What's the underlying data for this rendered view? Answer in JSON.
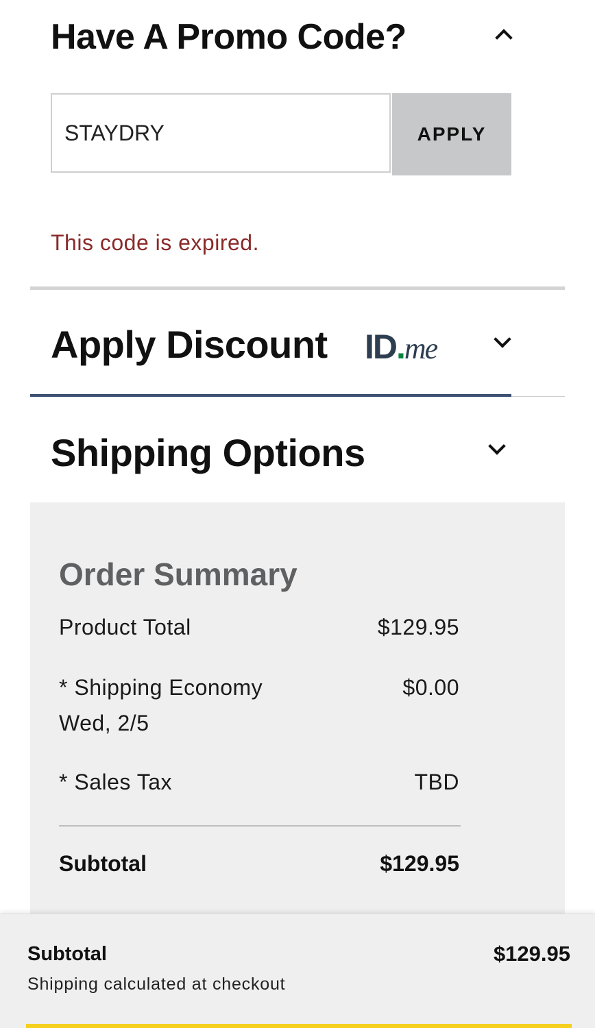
{
  "promo": {
    "title": "Have A Promo Code?",
    "input_value": "STAYDRY",
    "apply_label": "APPLY",
    "error": "This code is expired."
  },
  "discount": {
    "title": "Apply Discount",
    "logo_id": "ID",
    "logo_dot": ".",
    "logo_me": "me"
  },
  "shipping": {
    "title": "Shipping Options"
  },
  "summary": {
    "title": "Order Summary",
    "rows": [
      {
        "label": "Product Total",
        "value": "$129.95"
      },
      {
        "label": "* Shipping Economy",
        "sublabel": "Wed, 2/5",
        "value": "$0.00"
      },
      {
        "label": "* Sales Tax",
        "value": "TBD"
      }
    ],
    "subtotal_label": "Subtotal",
    "subtotal_value": "$129.95"
  },
  "footer": {
    "subtotal_label": "Subtotal",
    "subtotal_value": "$129.95",
    "note": "Shipping calculated at checkout"
  },
  "colors": {
    "error": "#8a2a2a",
    "accent_blue": "#3b5173",
    "apply_button": "#c7c8ca",
    "summary_bg": "#efefef",
    "checkout_yellow": "#f5d020",
    "idme_green": "#08833d"
  }
}
